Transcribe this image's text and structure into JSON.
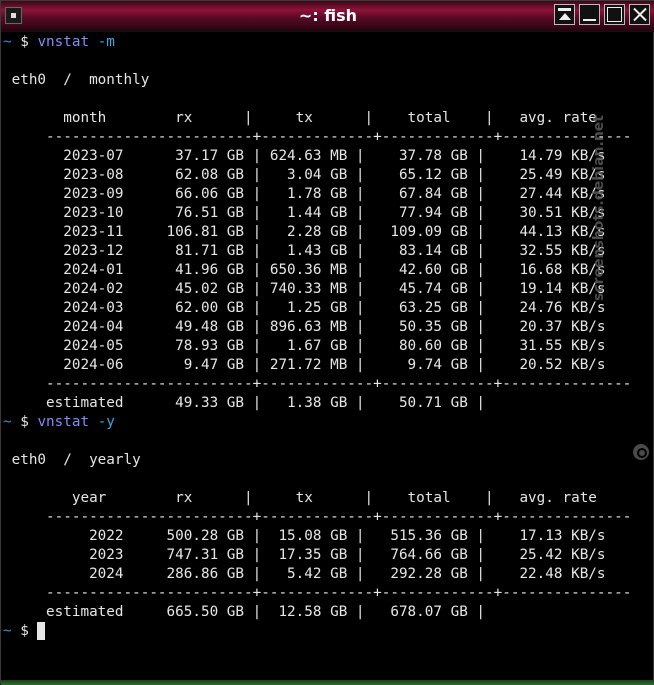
{
  "window": {
    "title": "~: fish"
  },
  "terminal": {
    "prompt_path": "~",
    "prompt_symbol": "$",
    "lines": [
      {
        "kind": "prompt",
        "cmd": "vnstat",
        "arg": " -m"
      },
      {
        "kind": "blank"
      },
      {
        "kind": "text",
        "text": " eth0  /  monthly"
      },
      {
        "kind": "blank"
      },
      {
        "kind": "text",
        "text": "       month        rx      |     tx      |    total    |   avg. rate"
      },
      {
        "kind": "text",
        "text": "     ------------------------+-------------+-------------+---------------"
      },
      {
        "kind": "text",
        "text": "       2023-07      37.17 GB | 624.63 MB |    37.78 GB |    14.79 KB/s"
      },
      {
        "kind": "text",
        "text": "       2023-08      62.08 GB |   3.04 GB |    65.12 GB |    25.49 KB/s"
      },
      {
        "kind": "text",
        "text": "       2023-09      66.06 GB |   1.78 GB |    67.84 GB |    27.44 KB/s"
      },
      {
        "kind": "text",
        "text": "       2023-10      76.51 GB |   1.44 GB |    77.94 GB |    30.51 KB/s"
      },
      {
        "kind": "text",
        "text": "       2023-11     106.81 GB |   2.28 GB |   109.09 GB |    44.13 KB/s"
      },
      {
        "kind": "text",
        "text": "       2023-12      81.71 GB |   1.43 GB |    83.14 GB |    32.55 KB/s"
      },
      {
        "kind": "text",
        "text": "       2024-01      41.96 GB | 650.36 MB |    42.60 GB |    16.68 KB/s"
      },
      {
        "kind": "text",
        "text": "       2024-02      45.02 GB | 740.33 MB |    45.74 GB |    19.14 KB/s"
      },
      {
        "kind": "text",
        "text": "       2024-03      62.00 GB |   1.25 GB |    63.25 GB |    24.76 KB/s"
      },
      {
        "kind": "text",
        "text": "       2024-04      49.48 GB | 896.63 MB |    50.35 GB |    20.37 KB/s"
      },
      {
        "kind": "text",
        "text": "       2024-05      78.93 GB |   1.67 GB |    80.60 GB |    31.55 KB/s"
      },
      {
        "kind": "text",
        "text": "       2024-06       9.47 GB | 271.72 MB |     9.74 GB |    20.52 KB/s"
      },
      {
        "kind": "text",
        "text": "     ------------------------+-------------+-------------+---------------"
      },
      {
        "kind": "text",
        "text": "     estimated      49.33 GB |   1.38 GB |    50.71 GB |"
      },
      {
        "kind": "prompt",
        "cmd": "vnstat",
        "arg": " -y"
      },
      {
        "kind": "blank"
      },
      {
        "kind": "text",
        "text": " eth0  /  yearly"
      },
      {
        "kind": "blank"
      },
      {
        "kind": "text",
        "text": "        year        rx      |     tx      |    total    |   avg. rate"
      },
      {
        "kind": "text",
        "text": "     ------------------------+-------------+-------------+---------------"
      },
      {
        "kind": "text",
        "text": "          2022     500.28 GB |  15.08 GB |   515.36 GB |    17.13 KB/s"
      },
      {
        "kind": "text",
        "text": "          2023     747.31 GB |  17.35 GB |   764.66 GB |    25.42 KB/s"
      },
      {
        "kind": "text",
        "text": "          2024     286.86 GB |   5.42 GB |   292.28 GB |    22.48 KB/s"
      },
      {
        "kind": "text",
        "text": "     ------------------------+-------------+-------------+---------------"
      },
      {
        "kind": "text",
        "text": "     estimated     665.50 GB |  12.58 GB |   678.07 GB |"
      },
      {
        "kind": "prompt_cursor"
      }
    ]
  },
  "watermark": {
    "text": "screenshots.debian.net"
  },
  "colors": {
    "titlebar": "#8d1238",
    "background": "#000000",
    "foreground": "#e6e6e6",
    "prompt": "#2d8fd8",
    "command": "#7d8ff5"
  }
}
